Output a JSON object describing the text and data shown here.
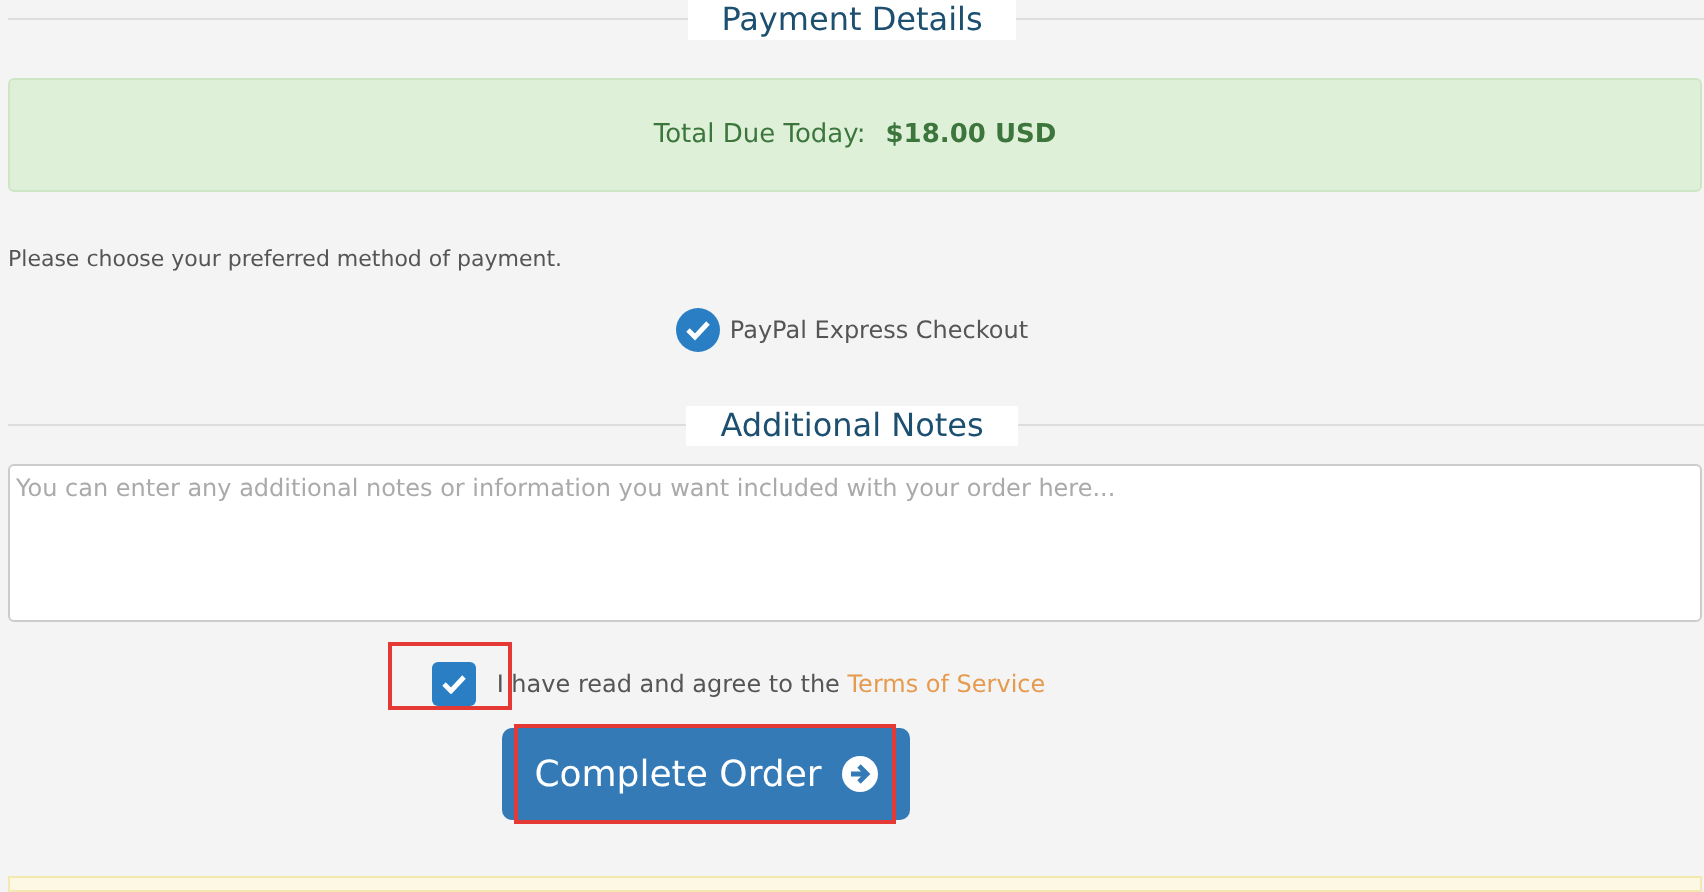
{
  "payment_section": {
    "title": "Payment Details"
  },
  "total": {
    "label": "Total Due Today:",
    "amount": "$18.00 USD"
  },
  "payment_prompt": "Please choose your preferred method of payment.",
  "payment_methods": [
    {
      "label": "PayPal Express Checkout",
      "selected": true
    }
  ],
  "notes_section": {
    "title": "Additional Notes",
    "placeholder": "You can enter any additional notes or information you want included with your order here..."
  },
  "terms": {
    "text": "I have read and agree to the",
    "link": "Terms of Service",
    "checked": true,
    "highlighted": true
  },
  "complete_button": {
    "label": "Complete Order",
    "highlighted": true
  }
}
